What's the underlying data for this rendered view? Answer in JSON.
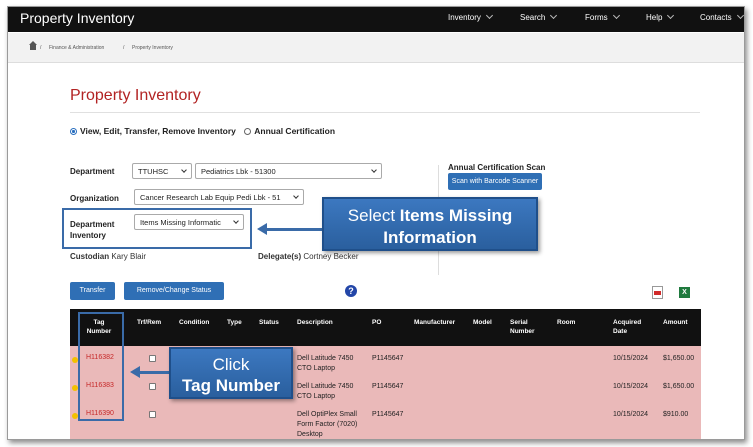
{
  "navbar": {
    "brand": "Property Inventory",
    "items": [
      "Inventory",
      "Search",
      "Forms",
      "Help",
      "Contacts"
    ]
  },
  "breadcrumb": {
    "items": [
      "Finance & Administration",
      "Property Inventory"
    ]
  },
  "page": {
    "title": "Property Inventory",
    "radio_options": [
      "View, Edit, Transfer, Remove Inventory",
      "Annual Certification"
    ],
    "radio_selected": "View, Edit, Transfer, Remove Inventory"
  },
  "form": {
    "department_label": "Department",
    "department_value": "TTUHSC",
    "department_sub_value": "Pediatrics Lbk - 51300",
    "organization_label": "Organization",
    "organization_value": "Cancer Research Lab Equip Pedi Lbk - 51",
    "dept_inventory_label": "Department Inventory",
    "dept_inventory_value": "Items Missing Informatic",
    "custodian_label": "Custodian",
    "custodian_value": "Kary Blair",
    "delegate_label": "Delegate(s)",
    "delegate_value": "Cortney Becker",
    "annual_cert_label": "Annual Certification Scan",
    "scan_button": "Scan with Barcode Scanner"
  },
  "actions": {
    "transfer": "Transfer",
    "remove": "Remove/Change Status",
    "help": "?",
    "excel": "X"
  },
  "table": {
    "headers": [
      "Tag Number",
      "Trf/Rem",
      "Condition",
      "Type",
      "Status",
      "Description",
      "PO",
      "Manufacturer",
      "Model",
      "Serial Number",
      "Room",
      "Acquired Date",
      "Amount"
    ],
    "rows": [
      {
        "tag": "H116382",
        "description": "Dell Latitude 7450 CTO Laptop",
        "po": "P1145647",
        "acquired": "10/15/2024",
        "amount": "$1,650.00"
      },
      {
        "tag": "H116383",
        "description": "Dell Latitude 7450 CTO Laptop",
        "po": "P1145647",
        "acquired": "10/15/2024",
        "amount": "$1,650.00"
      },
      {
        "tag": "H116390",
        "description": "Dell OptiPlex Small Form Factor (7020) Desktop",
        "po": "P1145647",
        "acquired": "10/15/2024",
        "amount": "$910.00"
      }
    ]
  },
  "callouts": {
    "items_missing_pre": "Select ",
    "items_missing_bold": "Items Missing",
    "items_missing_line2": "Information",
    "click": "Click",
    "tag_number": "Tag Number"
  },
  "colors": {
    "accent": "#2f6fb5",
    "title": "#b22323",
    "row_bg": "#eab9b9",
    "navbar": "#111111"
  }
}
